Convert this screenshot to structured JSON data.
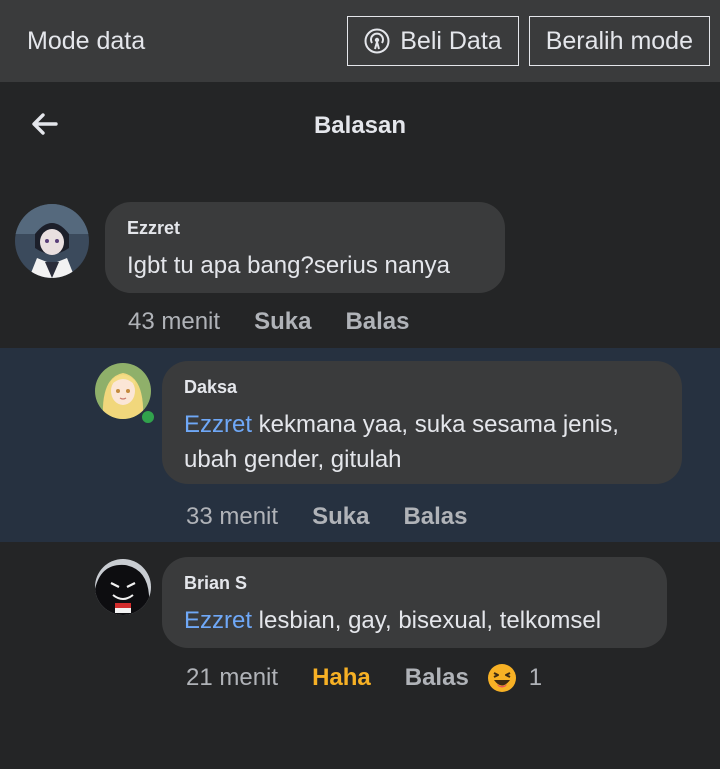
{
  "banner": {
    "label": "Mode data",
    "buy_label": "Beli Data",
    "switch_label": "Beralih mode"
  },
  "header": {
    "title": "Balasan"
  },
  "comments": [
    {
      "author": "Ezzret",
      "mention": "",
      "text": "Igbt tu apa bang?serius nanya",
      "time": "43 menit",
      "like_label": "Suka",
      "reply_label": "Balas"
    },
    {
      "author": "Daksa",
      "mention": "Ezzret",
      "text": " kekmana yaa, suka sesama jenis, ubah gender, gitulah",
      "time": "33 menit",
      "like_label": "Suka",
      "reply_label": "Balas",
      "online": true
    },
    {
      "author": "Brian S",
      "mention": "Ezzret",
      "text": " lesbian, gay, bisexual, telkomsel",
      "time": "21 menit",
      "like_label": "Haha",
      "reply_label": "Balas",
      "reaction_icon": "laughing-emoji-icon",
      "reaction_count": "1"
    }
  ],
  "colors": {
    "background": "#242526",
    "banner": "#3a3b3c",
    "bubble": "#3a3b3c",
    "highlight": "#263140",
    "mention": "#6fa8f7",
    "haha": "#f7b125",
    "online": "#31a24c"
  }
}
